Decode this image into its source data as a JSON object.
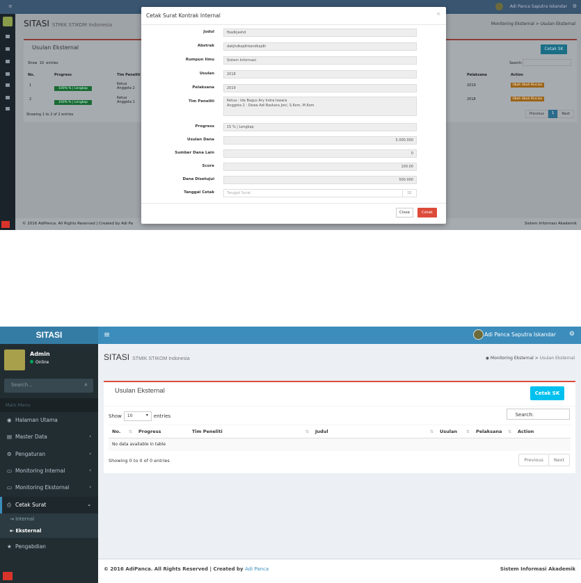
{
  "top": {
    "header_user": "Adi Panca Saputra Iskandar",
    "app_title": "SITASI",
    "app_subtitle": "STMIK STIKOM Indonesia",
    "crumb": "Monitoring Eksternal  >  Usulan Eksternal",
    "box_title": "Usulan Eksternal",
    "cetak_sk": "Cetak SK",
    "show": "Show",
    "entries_num": "10",
    "entries": "entries",
    "search": "Search:",
    "columns": [
      "No.",
      "Progress",
      "Tim Peneliti",
      "Pelaksana",
      "Action"
    ],
    "rows": [
      {
        "no": "1",
        "progress": "100% % | Lengkap",
        "tim": "Ketua\nAnggota 2",
        "pelaksana": "2019",
        "action": "Ubah Ubah Rincian"
      },
      {
        "no": "2",
        "progress": "100% % | Lengkap",
        "tim": "Ketua\nAnggota 1",
        "pelaksana": "2018",
        "action": "Ubah Ubah Rincian"
      }
    ],
    "showing": "Showing 1 to 2 of 2 entries",
    "pager": [
      "Previous",
      "1",
      "Next"
    ],
    "footer_left": "© 2016 AdiPanca. All Rights Reserved | Created by Adi Pa",
    "footer_right": "Sistem Informasi Akademik",
    "modal": {
      "title": "Cetak Surat Kontrak Internal",
      "close_x": "×",
      "fields": [
        {
          "label": "Judul",
          "value": "fbadkjashd"
        },
        {
          "label": "Abstrak",
          "value": "dakjhdkajdhkandkajdh"
        },
        {
          "label": "Rumpun Ilmu",
          "value": "Sistem Informasi"
        },
        {
          "label": "Usulan",
          "value": "2018"
        },
        {
          "label": "Pelaksana",
          "value": "2019"
        },
        {
          "label": "Tim Peneliti",
          "value": "Ketua : Ida Bagus Ary Indra Iswara\nAnggota 2 : Dewa Adi Baskara Joni, S.Kom, M.Kom"
        },
        {
          "label": "Progress",
          "value": "15 % | Lengkap"
        },
        {
          "label": "Usulan Dana",
          "value": "5.000.000"
        },
        {
          "label": "Sumber Dana Lain",
          "value": "0"
        },
        {
          "label": "Score",
          "value": "100.00"
        },
        {
          "label": "Dana Disetujui",
          "value": "500.000"
        },
        {
          "label": "Tanggal Cetak",
          "placeholder": "Tanggal Surat"
        }
      ],
      "btn_close": "Close",
      "btn_cetak": "Cetak"
    }
  },
  "bottom": {
    "logo": "SITASI",
    "hamburger": "≡",
    "user_name": "Adi Panca Saputra Iskandar",
    "sidebar": {
      "user": "Admin",
      "status": "Online",
      "search_placeholder": "Search...",
      "menu_header": "Main Menu",
      "items": [
        {
          "label": "Halaman Utama",
          "icon": "dashboard-icon"
        },
        {
          "label": "Master Data",
          "icon": "database-icon"
        },
        {
          "label": "Pengaturan",
          "icon": "gears-icon"
        },
        {
          "label": "Monitoring Internal",
          "icon": "desktop-icon"
        },
        {
          "label": "Monitoring Ekstornal",
          "icon": "desktop-icon"
        },
        {
          "label": "Cetak Surat",
          "icon": "print-icon"
        }
      ],
      "sub_items": [
        {
          "label": "Internal"
        },
        {
          "label": "Eksternal"
        }
      ],
      "last_item": "Pengabdian"
    },
    "page_title": "SITASI",
    "page_subtitle": "STMIK STIKOM Indonesia",
    "crumb_parent": "Monitoring Eksternal",
    "crumb_current": "Usulan Eksternal",
    "box_title": "Usulan Eksternal",
    "cetak_sk": "Cetak SK",
    "show": "Show",
    "entries_num": "10",
    "entries": "entries",
    "search": "Search:",
    "columns": [
      "No.",
      "Progress",
      "Tim Peneliti",
      "Judul",
      "Usulan",
      "Pelaksana",
      "Action"
    ],
    "empty": "No data available in table",
    "showing": "Showing 0 to 0 of 0 entries",
    "pager": [
      "Previous",
      "Next"
    ],
    "footer_left": "© 2016 AdiPanca. All Rights Reserved | Created by",
    "footer_link": "Adi Panca",
    "footer_right": "Sistem Informasi Akademik"
  },
  "colors": {
    "header": "#3c8dbc",
    "sidebar": "#222d32",
    "cetak": "#dd4b39",
    "cetak_sk": "#00c0ef"
  }
}
